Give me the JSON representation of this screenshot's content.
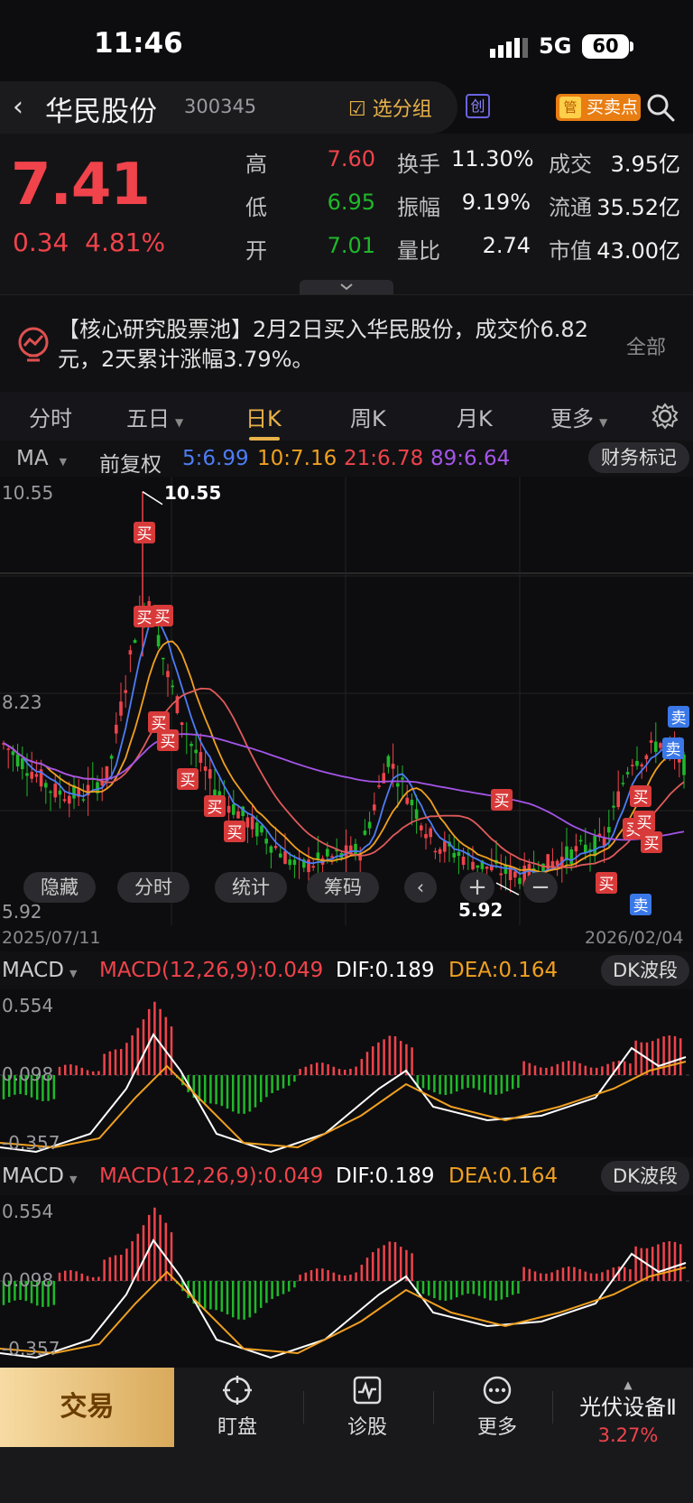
{
  "status_bar": {
    "time": "11:46",
    "network": "5G",
    "battery": "60"
  },
  "header": {
    "stock_name": "华民股份",
    "stock_code": "300345",
    "group_button": "选分组",
    "board_badge": "创",
    "buy_point_tag": "管",
    "buy_point_label": "买卖点"
  },
  "quote": {
    "price": "7.41",
    "change": "0.34",
    "change_pct": "4.81%",
    "rows": [
      {
        "l1": "高",
        "v1": "7.60",
        "c1": "red",
        "l2": "换手",
        "v2": "11.30%",
        "l3": "成交",
        "v3": "3.95亿"
      },
      {
        "l1": "低",
        "v1": "6.95",
        "c1": "green",
        "l2": "振幅",
        "v2": "9.19%",
        "l3": "流通",
        "v3": "35.52亿"
      },
      {
        "l1": "开",
        "v1": "7.01",
        "c1": "green",
        "l2": "量比",
        "v2": "2.74",
        "l3": "市值",
        "v3": "43.00亿"
      }
    ]
  },
  "news": {
    "text": "【核心研究股票池】2月2日买入华民股份，成交价6.82元，2天累计涨幅3.79%。",
    "all_label": "全部"
  },
  "tabs": [
    "分时",
    "五日",
    "日K",
    "周K",
    "月K",
    "更多"
  ],
  "active_tab": "日K",
  "ma_row": {
    "indicator": "MA",
    "adjust": "前复权",
    "ma5": "5:6.99",
    "ma10": "10:7.16",
    "ma21": "21:6.78",
    "ma89": "89:6.64",
    "finance_mark": "财务标记"
  },
  "kline": {
    "y_top": "10.55",
    "y_mid": "8.23",
    "y_bottom": "5.92",
    "high_marker": "10.55",
    "low_marker": "5.92",
    "date_start": "2025/07/11",
    "date_end": "2026/02/04",
    "overlay_buttons": [
      "隐藏",
      "分时",
      "统计",
      "筹码"
    ],
    "buy_label": "买",
    "sell_label": "卖"
  },
  "macd": {
    "name": "MACD",
    "formula": "MACD(12,26,9):0.049",
    "dif": "DIF:0.189",
    "dea": "DEA:0.164",
    "dk": "DK波段",
    "y_top": "0.554",
    "y_mid": "0.098",
    "y_bottom": "-0.357"
  },
  "bottom": {
    "trade": "交易",
    "nav": [
      "盯盘",
      "诊股",
      "更多"
    ],
    "sector_name": "光伏设备Ⅱ",
    "sector_pct": "3.27%"
  },
  "colors": {
    "up": "#f0434b",
    "down": "#1fb82a",
    "ma5": "#4e7cf5",
    "ma10": "#f0a020",
    "ma21": "#e05a5a",
    "ma89": "#a455e8",
    "accent": "#e8b24a"
  }
}
